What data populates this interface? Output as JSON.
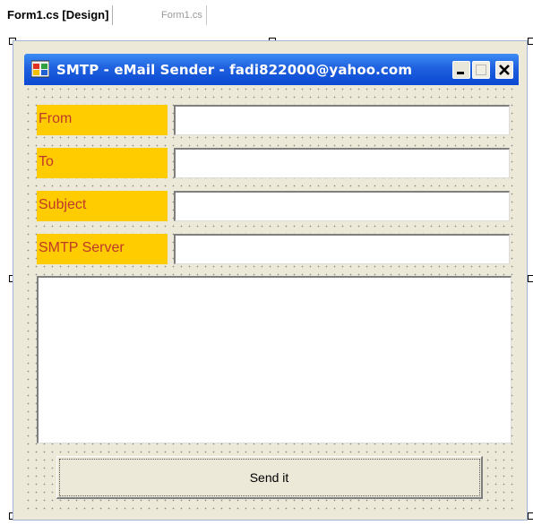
{
  "ide_tabs": [
    {
      "label": "Form1.cs [Design]"
    },
    {
      "label": "Form1.cs"
    }
  ],
  "window": {
    "title": "SMTP - eMail Sender - fadi822000@yahoo.com",
    "icon": "app-icon"
  },
  "fields": [
    {
      "label": "From",
      "value": ""
    },
    {
      "label": "To",
      "value": ""
    },
    {
      "label": "Subject",
      "value": ""
    },
    {
      "label": "SMTP Server",
      "value": ""
    }
  ],
  "message_body": "",
  "send_button": "Send it",
  "colors": {
    "label_background": "#ffcc00",
    "label_text": "#c0392b",
    "titlebar": "#1f60df"
  }
}
